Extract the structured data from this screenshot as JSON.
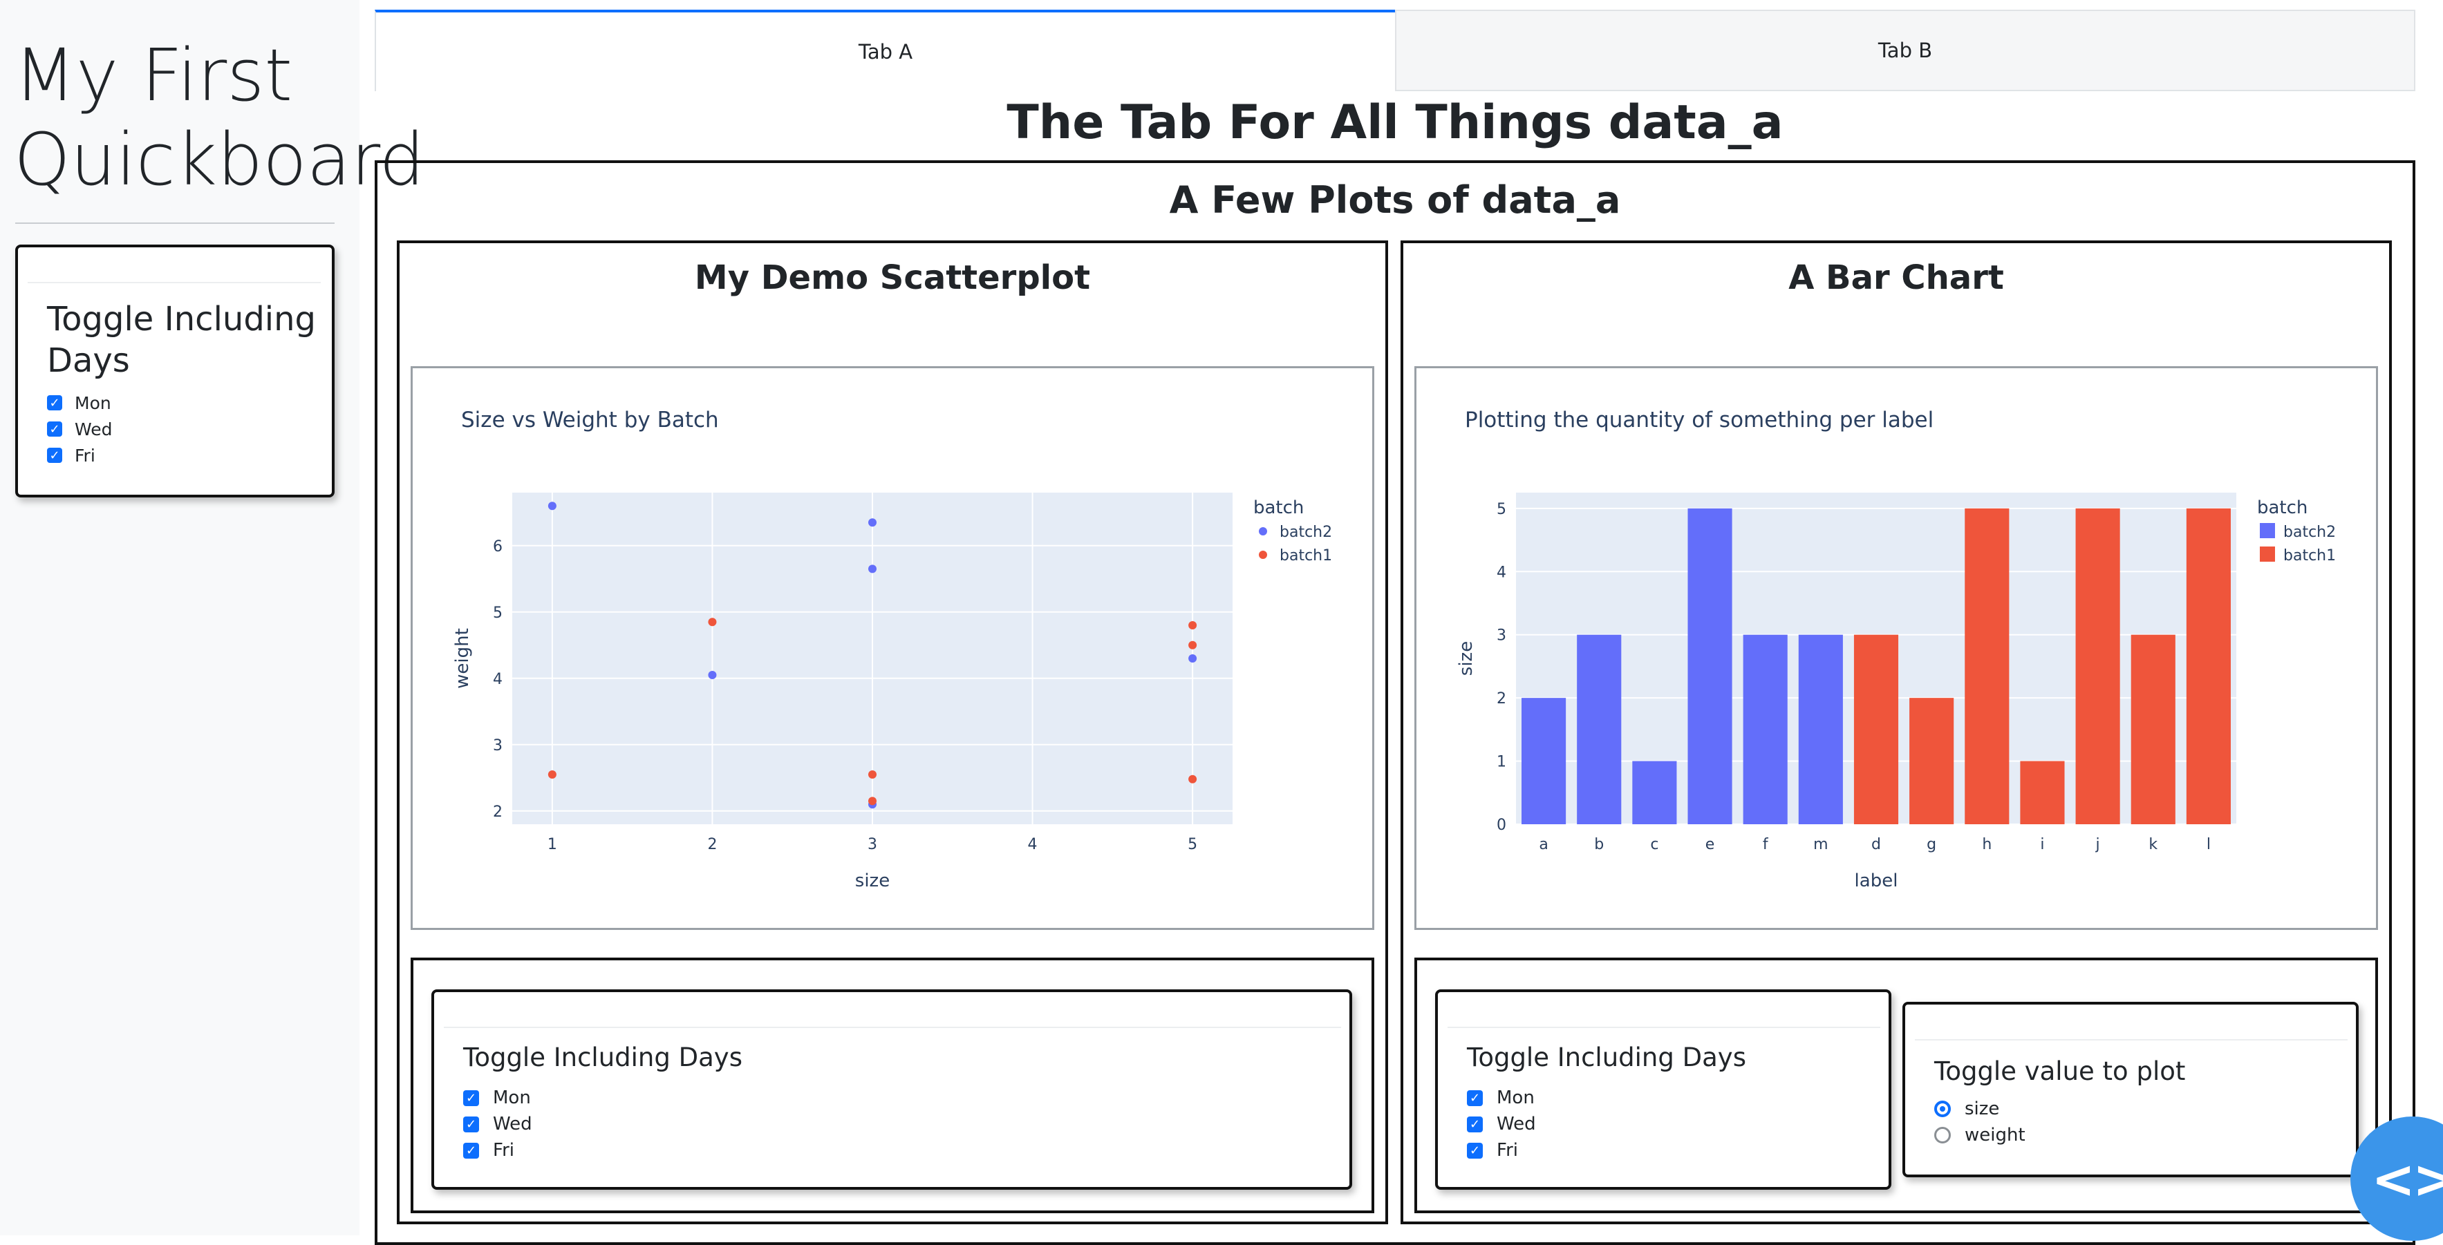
{
  "app": {
    "title_line1": "My First",
    "title_line2": "Quickboard"
  },
  "sidebar": {
    "days_card": {
      "title_line1": "Toggle Including",
      "title_line2": "Days",
      "options": [
        "Mon",
        "Wed",
        "Fri"
      ],
      "checked": [
        true,
        true,
        true
      ]
    }
  },
  "tabs": [
    {
      "label": "Tab A",
      "active": true
    },
    {
      "label": "Tab B",
      "active": false
    }
  ],
  "page": {
    "heading": "The Tab For All Things data_a",
    "section_title": "A Few Plots of data_a"
  },
  "scatter_panel": {
    "heading": "My Demo Scatterplot",
    "controls": {
      "title": "Toggle Including Days",
      "options": [
        "Mon",
        "Wed",
        "Fri"
      ],
      "checked": [
        true,
        true,
        true
      ]
    }
  },
  "bar_panel": {
    "heading": "A Bar Chart",
    "days_controls": {
      "title": "Toggle Including Days",
      "options": [
        "Mon",
        "Wed",
        "Fri"
      ],
      "checked": [
        true,
        true,
        true
      ]
    },
    "value_controls": {
      "title": "Toggle value to plot",
      "options": [
        "size",
        "weight"
      ],
      "selected": "size"
    }
  },
  "colors": {
    "batch2": "#636efa",
    "batch1": "#ef553b",
    "plot_bg": "#e5ecf6",
    "accent": "#0d6efd"
  },
  "icons": {
    "code_button": "code-brackets-icon"
  },
  "chart_data": [
    {
      "type": "scatter",
      "title": "Size vs Weight by Batch",
      "xlabel": "size",
      "ylabel": "weight",
      "xlim": [
        0.75,
        5.25
      ],
      "ylim": [
        1.8,
        6.8
      ],
      "xticks": [
        1,
        2,
        3,
        4,
        5
      ],
      "yticks": [
        2,
        3,
        4,
        5,
        6
      ],
      "grid": true,
      "legend_title": "batch",
      "legend_position": "top-right",
      "series": [
        {
          "name": "batch2",
          "color": "#636efa",
          "points": [
            [
              1,
              6.6
            ],
            [
              2,
              4.05
            ],
            [
              3,
              6.35
            ],
            [
              3,
              5.65
            ],
            [
              3,
              2.1
            ],
            [
              5,
              4.3
            ]
          ]
        },
        {
          "name": "batch1",
          "color": "#ef553b",
          "points": [
            [
              1,
              2.55
            ],
            [
              2,
              4.85
            ],
            [
              3,
              2.55
            ],
            [
              3,
              2.15
            ],
            [
              5,
              4.8
            ],
            [
              5,
              4.5
            ],
            [
              5,
              2.48
            ]
          ]
        }
      ]
    },
    {
      "type": "bar",
      "title": "Plotting the quantity of something per label",
      "xlabel": "label",
      "ylabel": "size",
      "ylim": [
        0,
        5.25
      ],
      "yticks": [
        0,
        1,
        2,
        3,
        4,
        5
      ],
      "grid": true,
      "legend_title": "batch",
      "legend_position": "top-right",
      "categories": [
        "a",
        "b",
        "c",
        "e",
        "f",
        "m",
        "d",
        "g",
        "h",
        "i",
        "j",
        "k",
        "l"
      ],
      "values": [
        2,
        3,
        1,
        5,
        3,
        3,
        3,
        2,
        5,
        1,
        5,
        3,
        5
      ],
      "batches": [
        "batch2",
        "batch2",
        "batch2",
        "batch2",
        "batch2",
        "batch2",
        "batch1",
        "batch1",
        "batch1",
        "batch1",
        "batch1",
        "batch1",
        "batch1"
      ],
      "series": [
        {
          "name": "batch2",
          "color": "#636efa"
        },
        {
          "name": "batch1",
          "color": "#ef553b"
        }
      ]
    }
  ]
}
